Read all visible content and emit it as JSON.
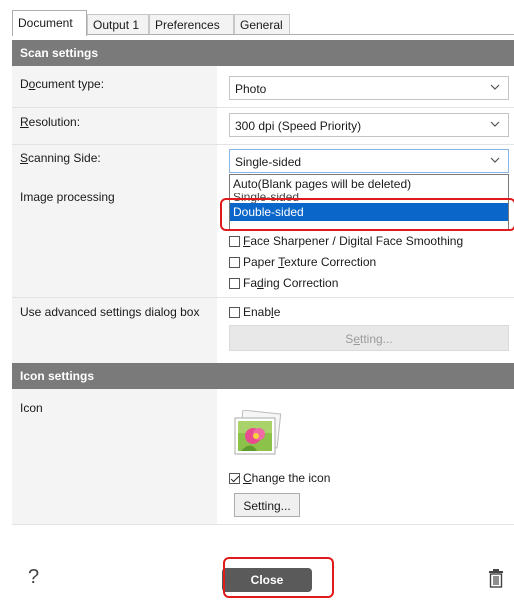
{
  "tabs": [
    {
      "label": "Document",
      "active": true
    },
    {
      "label": "Output 1",
      "active": false
    },
    {
      "label": "Preferences",
      "active": false
    },
    {
      "label": "General",
      "active": false
    }
  ],
  "scan_settings": {
    "header": "Scan settings",
    "document_type": {
      "label": "Document type:",
      "value": "Photo"
    },
    "resolution": {
      "label": "Resolution:",
      "value": "300 dpi (Speed Priority)"
    },
    "scanning_side": {
      "label": "Scanning Side:",
      "value": "Single-sided",
      "options": [
        "Auto(Blank pages will be deleted)",
        "Single-sided",
        "Double-sided"
      ]
    },
    "image_processing": {
      "label": "Image processing",
      "options": [
        {
          "label": "Face Sharpener / Digital Face Smoothing",
          "checked": false
        },
        {
          "label": "Paper Texture Correction",
          "checked": false
        },
        {
          "label": "Fading Correction",
          "checked": false
        }
      ]
    },
    "advanced": {
      "label": "Use advanced settings dialog box",
      "enable_label": "Enable",
      "enable_checked": false,
      "setting_button": "Setting..."
    }
  },
  "icon_settings": {
    "header": "Icon settings",
    "icon_label": "Icon",
    "change_icon_label": "Change the icon",
    "change_icon_checked": true,
    "setting_button": "Setting..."
  },
  "footer": {
    "help_glyph": "?",
    "close_button": "Close"
  },
  "colors": {
    "section_header": "#7a7a7a",
    "selection": "#0a66c9",
    "highlight": "#e01a1a"
  }
}
